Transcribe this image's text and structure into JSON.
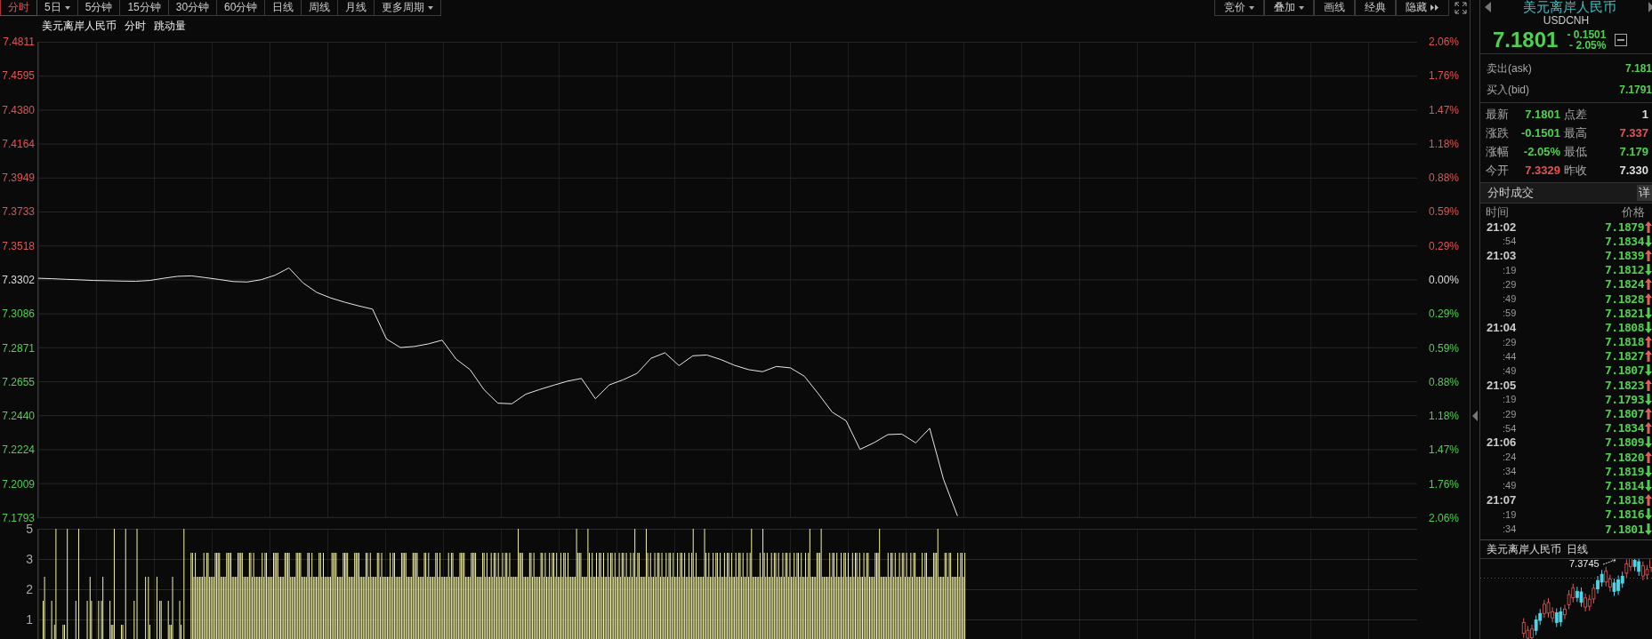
{
  "toolbar": {
    "periods": [
      {
        "label": "分时",
        "selected": true,
        "dropdown": false
      },
      {
        "label": "5日",
        "selected": false,
        "dropdown": true
      },
      {
        "label": "5分钟",
        "selected": false,
        "dropdown": false
      },
      {
        "label": "15分钟",
        "selected": false,
        "dropdown": false
      },
      {
        "label": "30分钟",
        "selected": false,
        "dropdown": false
      },
      {
        "label": "60分钟",
        "selected": false,
        "dropdown": false
      },
      {
        "label": "日线",
        "selected": false,
        "dropdown": false
      },
      {
        "label": "周线",
        "selected": false,
        "dropdown": false
      },
      {
        "label": "月线",
        "selected": false,
        "dropdown": false
      },
      {
        "label": "更多周期",
        "selected": false,
        "dropdown": true
      }
    ],
    "tools": [
      {
        "label": "竞价",
        "kind": "menu"
      },
      {
        "label": "叠加",
        "kind": "menu"
      },
      {
        "label": "画线",
        "kind": "plain"
      },
      {
        "label": "经典",
        "kind": "plain"
      },
      {
        "label": "隐藏",
        "kind": "collapse"
      }
    ]
  },
  "chart": {
    "title": "美元离岸人民币",
    "mode": "分时",
    "indicator": "跳动量",
    "percent_ticks": [
      {
        "label": "2.06%",
        "color": "#e05454"
      },
      {
        "label": "1.76%",
        "color": "#e05454"
      },
      {
        "label": "1.47%",
        "color": "#e05454"
      },
      {
        "label": "1.18%",
        "color": "#e05454"
      },
      {
        "label": "0.88%",
        "color": "#e05454"
      },
      {
        "label": "0.59%",
        "color": "#e05454"
      },
      {
        "label": "0.29%",
        "color": "#e05454"
      },
      {
        "label": "0.00%",
        "color": "#dddddd"
      },
      {
        "label": "0.29%",
        "color": "#4fd04f"
      },
      {
        "label": "0.59%",
        "color": "#4fd04f"
      },
      {
        "label": "0.88%",
        "color": "#4fd04f"
      },
      {
        "label": "1.18%",
        "color": "#4fd04f"
      },
      {
        "label": "1.47%",
        "color": "#4fd04f"
      },
      {
        "label": "1.76%",
        "color": "#4fd04f"
      },
      {
        "label": "2.06%",
        "color": "#4fd04f"
      }
    ],
    "chart_data": {
      "type": "line",
      "categories": [
        null,
        null,
        null,
        null,
        null,
        null,
        null,
        null,
        null,
        null,
        null,
        null,
        null,
        null,
        null,
        null,
        null,
        null,
        null,
        null,
        null,
        null,
        null,
        null,
        null,
        null,
        null,
        null,
        null,
        null,
        null,
        null,
        null,
        null,
        null,
        null,
        null,
        null,
        null,
        null,
        null,
        null,
        null,
        null,
        null,
        null,
        null,
        null,
        null,
        null,
        null,
        null,
        null,
        null,
        null,
        null,
        null,
        null,
        null,
        null,
        null,
        null,
        null,
        null,
        null,
        null,
        null,
        null,
        null,
        null,
        null,
        null,
        null,
        null,
        null,
        null,
        null,
        null,
        null,
        null,
        null,
        null,
        null,
        null,
        null,
        null,
        null,
        null,
        null,
        null,
        null,
        null,
        null,
        null,
        null,
        null,
        null,
        null,
        null,
        null
      ],
      "series": [
        {
          "color": "#e8e8e8",
          "values": [
            7.331,
            7.3307,
            7.3303,
            7.33,
            7.3296,
            7.3294,
            7.3292,
            7.3291,
            7.3296,
            7.331,
            7.3322,
            7.3325,
            7.3314,
            7.3302,
            7.3289,
            7.3286,
            7.3301,
            7.3329,
            7.3376,
            7.3281,
            7.322,
            7.3185,
            7.3158,
            7.3135,
            7.3114,
            7.2925,
            7.287,
            7.2877,
            7.2893,
            7.2917,
            7.2797,
            7.273,
            7.2603,
            7.2517,
            7.2513,
            7.2574,
            7.2604,
            7.2631,
            7.2657,
            7.2674,
            7.2545,
            7.2633,
            7.2666,
            7.2707,
            7.2802,
            7.2837,
            7.2755,
            7.2818,
            7.2823,
            7.2794,
            7.2757,
            7.273,
            7.2717,
            7.275,
            7.2741,
            7.2688,
            7.2578,
            7.246,
            7.2405,
            7.2224,
            7.2266,
            7.2318,
            7.2321,
            7.2265,
            7.2358,
            7.2033,
            7.1801,
            null,
            null,
            null,
            null,
            null,
            null,
            null,
            null,
            null,
            null,
            null,
            null,
            null,
            null,
            null,
            null,
            null,
            null,
            null,
            null,
            null,
            null,
            null,
            null,
            null,
            null,
            null,
            null,
            null,
            null,
            null,
            null,
            null
          ]
        }
      ],
      "ylim": [
        7.1793,
        7.4811
      ],
      "yticks": [
        {
          "value": 7.4811,
          "label": "7.4811"
        },
        {
          "value": 7.4595,
          "label": "7.4595"
        },
        {
          "value": 7.438,
          "label": "7.4380"
        },
        {
          "value": 7.4164,
          "label": "7.4164"
        },
        {
          "value": 7.3949,
          "label": "7.3949"
        },
        {
          "value": 7.3733,
          "label": "7.3733"
        },
        {
          "value": 7.3518,
          "label": "7.3518"
        },
        {
          "value": 7.3302,
          "label": "7.3302"
        },
        {
          "value": 7.3086,
          "label": "7.3086"
        },
        {
          "value": 7.2871,
          "label": "7.2871"
        },
        {
          "value": 7.2655,
          "label": "7.2655"
        },
        {
          "value": 7.244,
          "label": "7.2440"
        },
        {
          "value": 7.2224,
          "label": "7.2224"
        },
        {
          "value": 7.2009,
          "label": "7.2009"
        },
        {
          "value": 7.1793,
          "label": "7.1793"
        }
      ]
    },
    "volume_ticks": [
      "5",
      "3",
      "2",
      "1"
    ]
  },
  "quote": {
    "name": "美元离岸人民币",
    "code": "USDCNH",
    "price": "7.1801",
    "change": "- 0.1501",
    "change_pct": "- 2.05%",
    "color": "#4fd04f",
    "ask_bid": [
      {
        "label": "卖出(ask)",
        "value": "7.181"
      },
      {
        "label": "买入(bid)",
        "value": "7.1791"
      }
    ],
    "stats": [
      [
        {
          "label": "最新",
          "value": "7.1801",
          "color": "#4fd04f"
        },
        {
          "label": "点差",
          "value": "1",
          "color": "#dddddd"
        }
      ],
      [
        {
          "label": "涨跌",
          "value": "-0.1501",
          "color": "#4fd04f"
        },
        {
          "label": "最高",
          "value": "7.337",
          "color": "#e05454"
        }
      ],
      [
        {
          "label": "涨幅",
          "value": "-2.05%",
          "color": "#4fd04f"
        },
        {
          "label": "最低",
          "value": "7.179",
          "color": "#4fd04f"
        }
      ],
      [
        {
          "label": "今开",
          "value": "7.3329",
          "color": "#e05454"
        },
        {
          "label": "昨收",
          "value": "7.330",
          "color": "#dddddd"
        }
      ]
    ]
  },
  "trades": {
    "title": "分时成交",
    "details_button": "详",
    "columns": [
      "时间",
      "价格"
    ],
    "rows": [
      {
        "time": "21:02",
        "kind": "minute",
        "price": "7.1879",
        "rising": true
      },
      {
        "time": ":54",
        "kind": "second",
        "price": "7.1834",
        "rising": false
      },
      {
        "time": "21:03",
        "kind": "minute",
        "price": "7.1839",
        "rising": true
      },
      {
        "time": ":19",
        "kind": "second",
        "price": "7.1812",
        "rising": false
      },
      {
        "time": ":29",
        "kind": "second",
        "price": "7.1824",
        "rising": true
      },
      {
        "time": ":49",
        "kind": "second",
        "price": "7.1828",
        "rising": true
      },
      {
        "time": ":59",
        "kind": "second",
        "price": "7.1821",
        "rising": false
      },
      {
        "time": "21:04",
        "kind": "minute",
        "price": "7.1808",
        "rising": false
      },
      {
        "time": ":29",
        "kind": "second",
        "price": "7.1818",
        "rising": true
      },
      {
        "time": ":44",
        "kind": "second",
        "price": "7.1827",
        "rising": true
      },
      {
        "time": ":49",
        "kind": "second",
        "price": "7.1807",
        "rising": false
      },
      {
        "time": "21:05",
        "kind": "minute",
        "price": "7.1823",
        "rising": true
      },
      {
        "time": ":19",
        "kind": "second",
        "price": "7.1793",
        "rising": false
      },
      {
        "time": ":29",
        "kind": "second",
        "price": "7.1807",
        "rising": true
      },
      {
        "time": ":54",
        "kind": "second",
        "price": "7.1834",
        "rising": true
      },
      {
        "time": "21:06",
        "kind": "minute",
        "price": "7.1809",
        "rising": false
      },
      {
        "time": ":24",
        "kind": "second",
        "price": "7.1820",
        "rising": true
      },
      {
        "time": ":34",
        "kind": "second",
        "price": "7.1819",
        "rising": false
      },
      {
        "time": ":49",
        "kind": "second",
        "price": "7.1814",
        "rising": false
      },
      {
        "time": "21:07",
        "kind": "minute",
        "price": "7.1818",
        "rising": true
      },
      {
        "time": ":19",
        "kind": "second",
        "price": "7.1816",
        "rising": false
      },
      {
        "time": ":34",
        "kind": "second",
        "price": "7.1801",
        "rising": false
      }
    ]
  },
  "mini_chart": {
    "title": "美元离岸人民币",
    "period": "日线",
    "high_label": "7.3745"
  }
}
